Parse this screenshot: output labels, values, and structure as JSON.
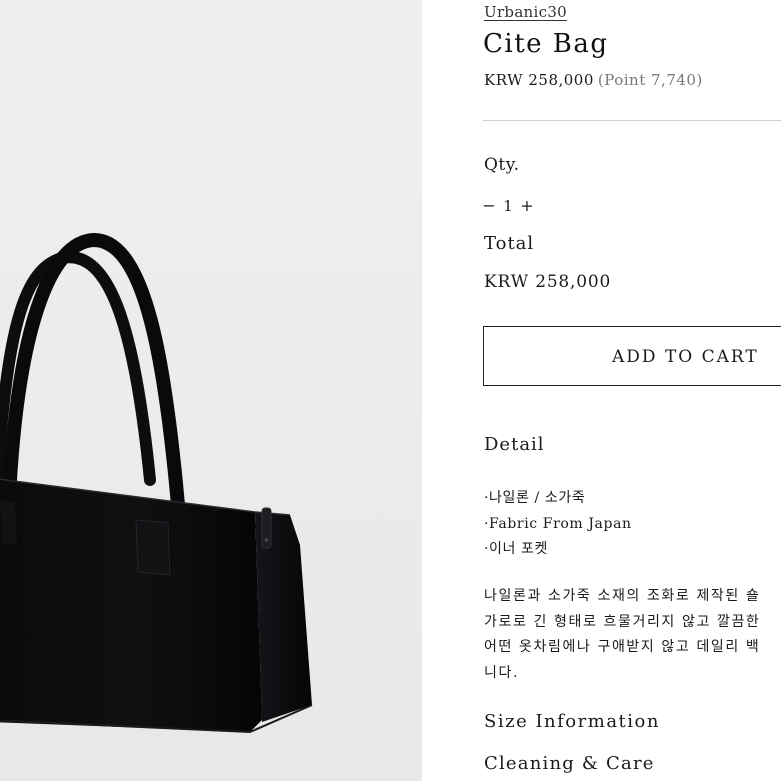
{
  "product": {
    "brand": "Urbanic30",
    "name": "Cite Bag",
    "price": "KRW 258,000",
    "points": "(Point 7,740)",
    "image_alt": "black nylon tote bag with leather handles"
  },
  "quantity": {
    "label": "Qty.",
    "minus": "−",
    "value": "1",
    "plus": "+"
  },
  "total": {
    "label": "Total",
    "value": "KRW 258,000"
  },
  "cart": {
    "button_label": "ADD TO CART"
  },
  "detail": {
    "title": "Detail",
    "bullets": [
      "·나일론 / 소가죽",
      "·Fabric From Japan",
      "·이너 포켓"
    ],
    "description": [
      "나일론과 소가죽 소재의 조화로 제작된 숄",
      "가로로 긴 형태로 흐물거리지 않고 깔끔한",
      "어떤 옷차림에나 구애받지 않고 데일리 백",
      "니다."
    ]
  },
  "sections": {
    "size_information": "Size Information",
    "cleaning_care": "Cleaning & Care"
  },
  "colors": {
    "background": "#ffffff",
    "photo_background": "#ececec",
    "bag": "#0b0b0d",
    "divider": "#cfcfcf",
    "text": "#1a1a1a",
    "muted": "#777777"
  }
}
